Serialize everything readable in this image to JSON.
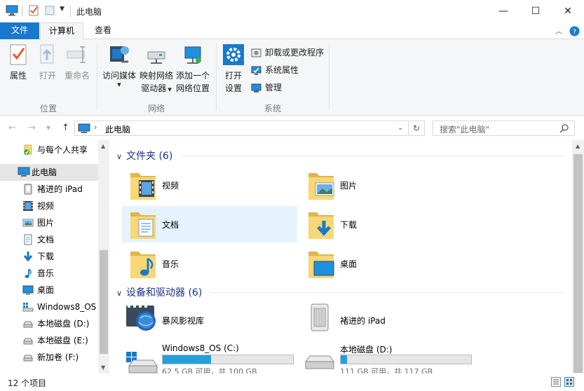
{
  "window": {
    "title": "此电脑",
    "controls": {
      "minimize": "—",
      "maximize": "☐",
      "close": "✕"
    }
  },
  "ribbon_tabs": {
    "file": "文件",
    "computer": "计算机",
    "view": "查看"
  },
  "ribbon": {
    "location": {
      "properties": "属性",
      "open": "打开",
      "rename": "重命名",
      "label": "位置"
    },
    "network": {
      "access_media": "访问媒体",
      "map_drive_line1": "映射网络",
      "map_drive_line2": "驱动器",
      "add_location_line1": "添加一个",
      "add_location_line2": "网络位置",
      "label": "网络"
    },
    "system": {
      "open_settings_line1": "打开",
      "open_settings_line2": "设置",
      "uninstall": "卸载或更改程序",
      "system_properties": "系统属性",
      "manage": "管理",
      "label": "系统"
    }
  },
  "address": {
    "path": "此电脑",
    "search_placeholder": "搜索\"此电脑\""
  },
  "nav": {
    "items": [
      {
        "label": "与每个人共享",
        "icon": "share-icon"
      },
      {
        "label": "此电脑",
        "icon": "pc-icon"
      },
      {
        "label": "褚进的 iPad",
        "icon": "ipad-icon"
      },
      {
        "label": "视频",
        "icon": "video-icon"
      },
      {
        "label": "图片",
        "icon": "pictures-icon"
      },
      {
        "label": "文档",
        "icon": "documents-icon"
      },
      {
        "label": "下载",
        "icon": "download-icon"
      },
      {
        "label": "音乐",
        "icon": "music-icon"
      },
      {
        "label": "桌面",
        "icon": "desktop-icon"
      },
      {
        "label": "Windows8_OS",
        "icon": "os-drive-icon"
      },
      {
        "label": "本地磁盘 (D:)",
        "icon": "drive-icon"
      },
      {
        "label": "本地磁盘 (E:)",
        "icon": "drive-icon"
      },
      {
        "label": "新加卷 (F:)",
        "icon": "drive-icon"
      }
    ]
  },
  "content": {
    "folders_header": "文件夹 (6)",
    "folders": [
      {
        "label": "视频",
        "icon": "video-folder-icon"
      },
      {
        "label": "图片",
        "icon": "pictures-folder-icon"
      },
      {
        "label": "文档",
        "icon": "documents-folder-icon"
      },
      {
        "label": "下载",
        "icon": "download-folder-icon"
      },
      {
        "label": "音乐",
        "icon": "music-folder-icon"
      },
      {
        "label": "桌面",
        "icon": "desktop-folder-icon"
      }
    ],
    "devices_header": "设备和驱动器 (6)",
    "devices": [
      {
        "label": "暴风影视库",
        "icon": "media-library-icon"
      },
      {
        "label": "褚进的 iPad",
        "icon": "ipad-device-icon"
      }
    ],
    "drives": [
      {
        "label": "Windows8_OS (C:)",
        "used_fraction": 0.37,
        "free_text": "62.5 GB 可用，共 100 GB"
      },
      {
        "label": "本地磁盘 (D:)",
        "used_fraction": 0.05,
        "free_text": "111 GB 可用，共 117 GB"
      }
    ]
  },
  "status": {
    "item_count": "12 个项目"
  },
  "colors": {
    "accent": "#1979ca",
    "selection": "#cce8ff",
    "hover": "#e5f3ff",
    "group_header": "#1e3287",
    "drive_fill": "#26a0da",
    "folder_yellow": "#f8d775"
  }
}
